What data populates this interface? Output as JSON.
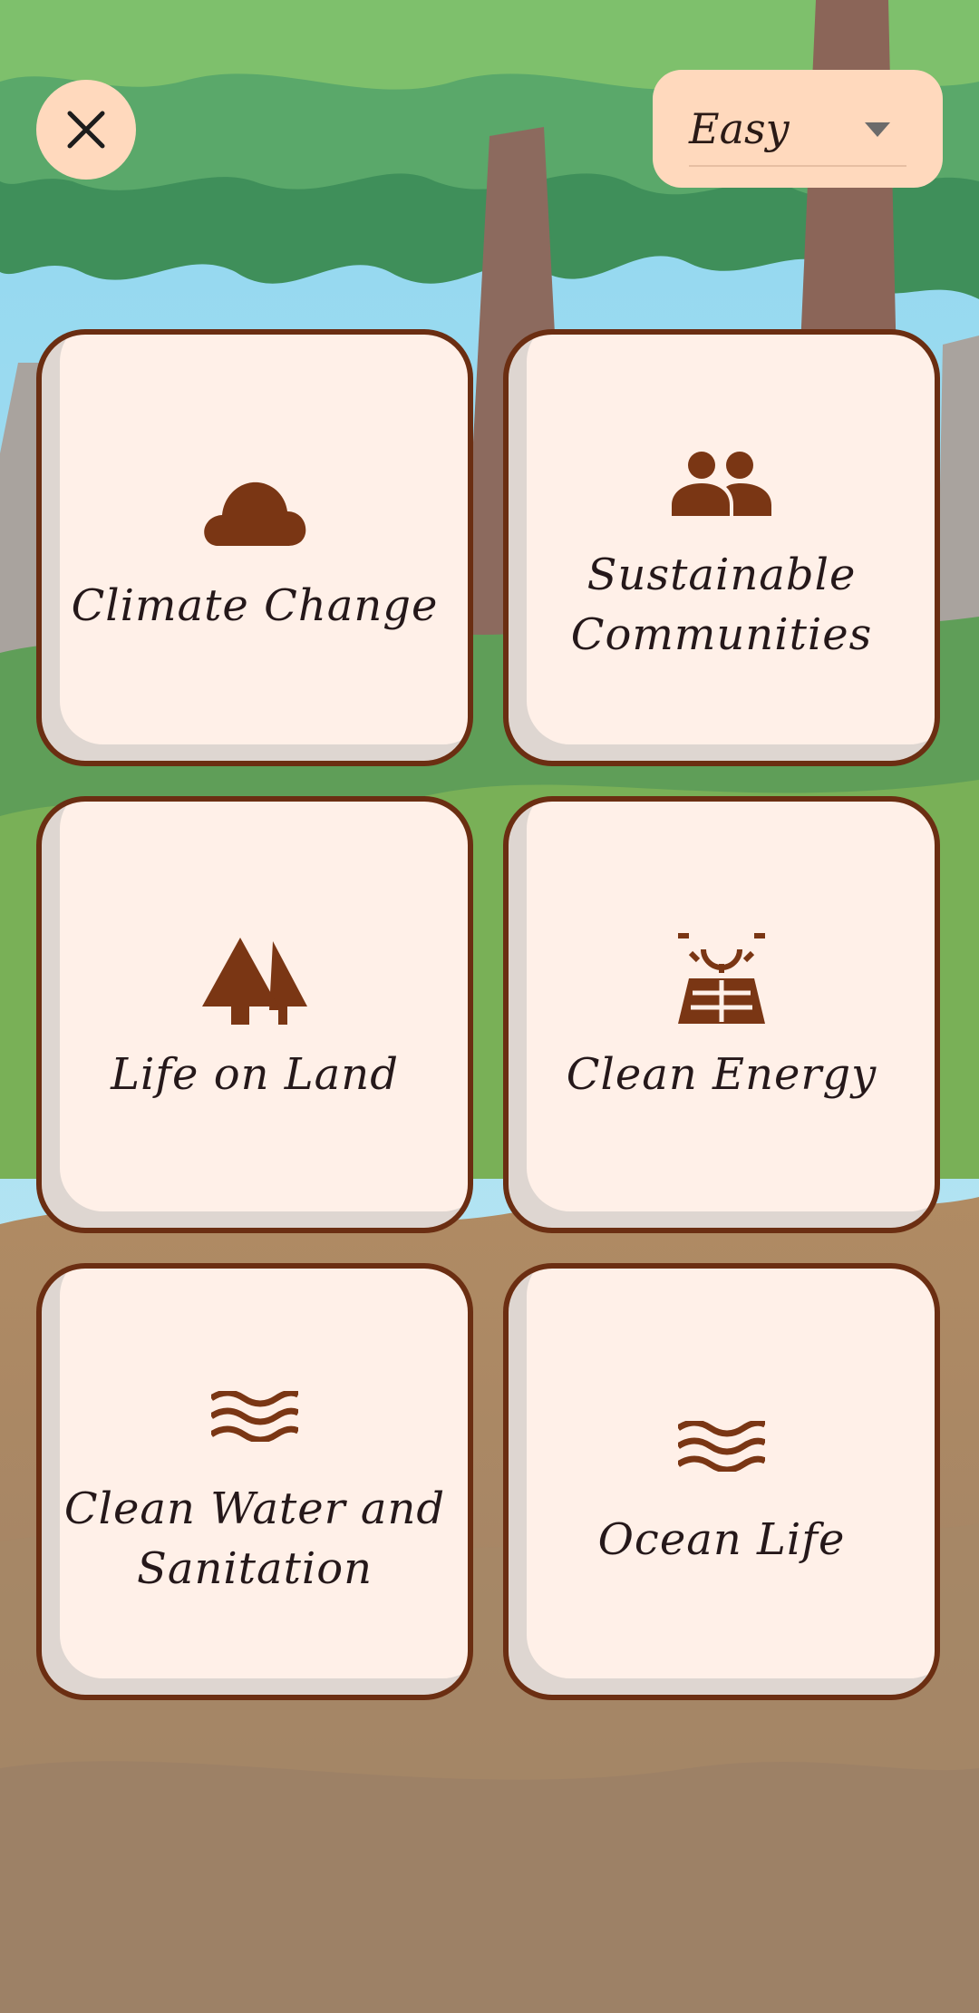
{
  "header": {
    "close_icon": "close-icon",
    "difficulty": {
      "selected": "Easy",
      "icon": "dropdown-caret-icon"
    }
  },
  "topics": [
    {
      "label": "Climate Change",
      "icon": "cloud-icon"
    },
    {
      "label": "Sustainable\nCommunities",
      "icon": "people-icon"
    },
    {
      "label": "Life on Land",
      "icon": "trees-icon"
    },
    {
      "label": "Clean Energy",
      "icon": "solar-panel-icon"
    },
    {
      "label": "Clean Water and\nSanitation",
      "icon": "water-waves-icon"
    },
    {
      "label": "Ocean Life",
      "icon": "ocean-waves-icon"
    }
  ],
  "colors": {
    "card_background": "#fff0e8",
    "card_border": "#6b2e12",
    "icon_color": "#7a3614",
    "button_background": "#ffd9bd",
    "text_color": "#25181a"
  }
}
